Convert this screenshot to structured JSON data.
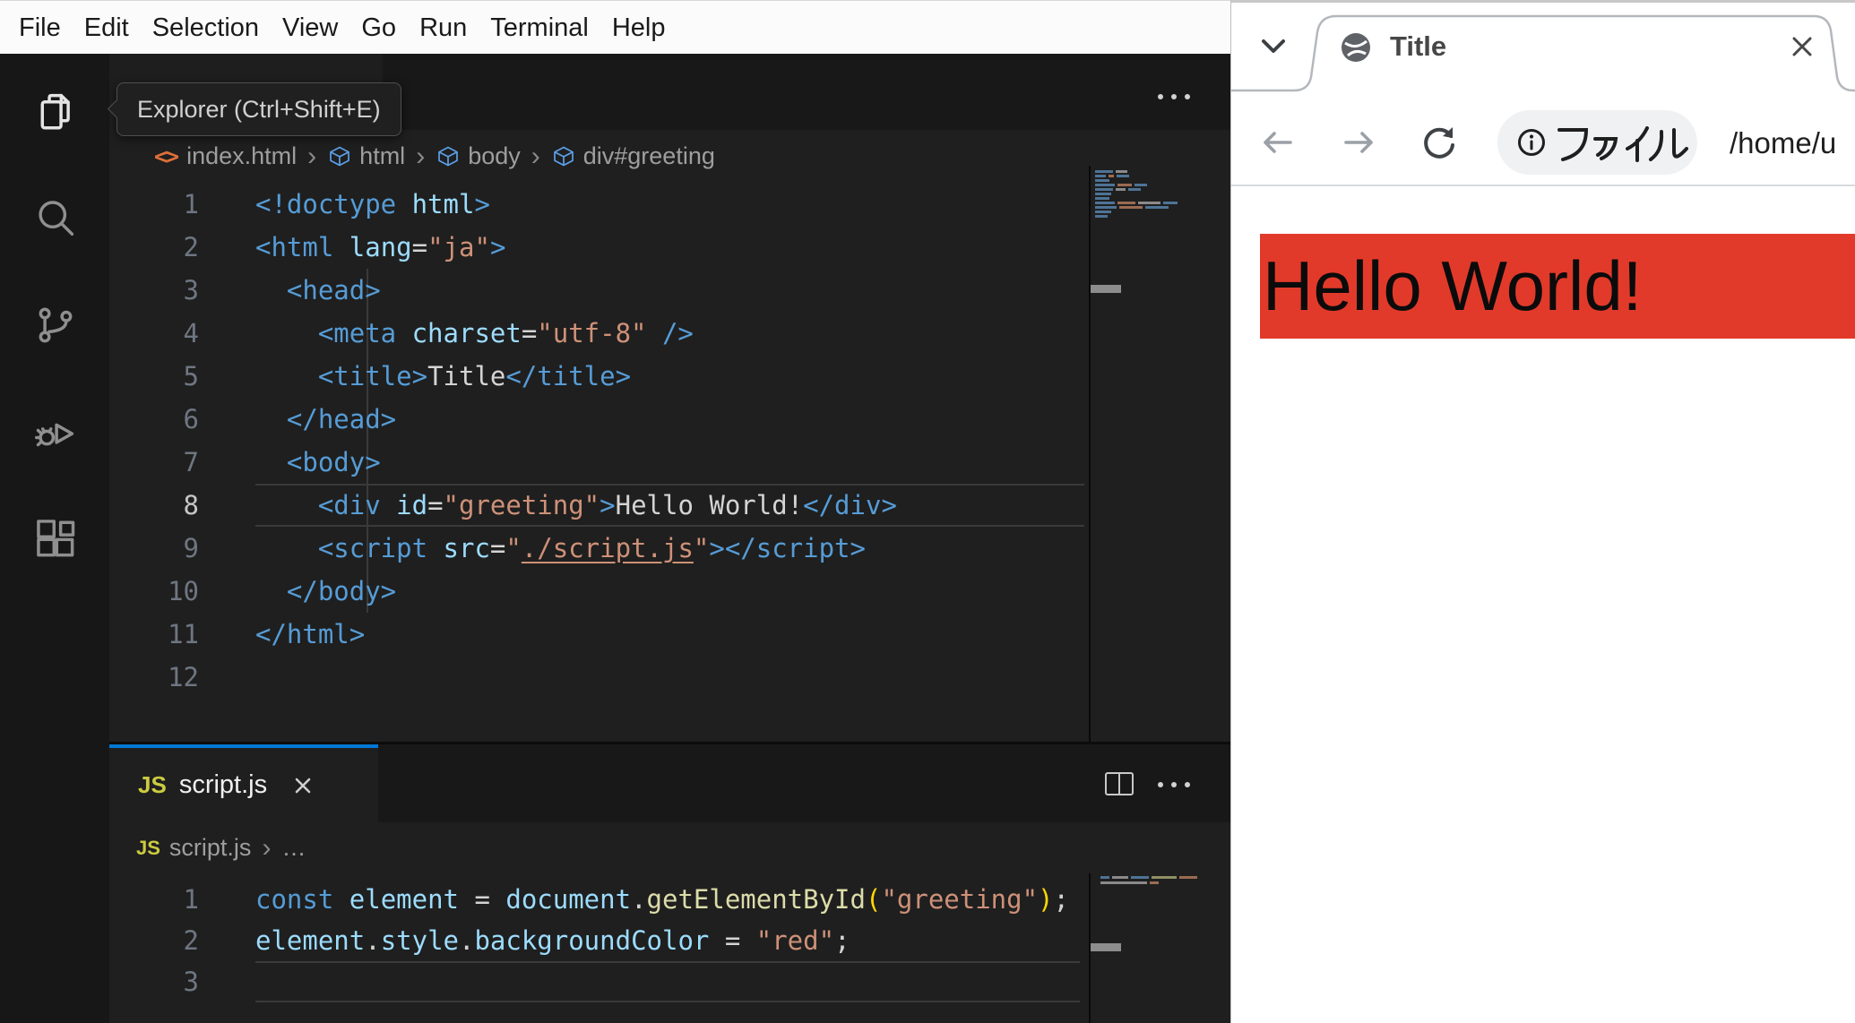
{
  "menu_bar": {
    "items": [
      "File",
      "Edit",
      "Selection",
      "View",
      "Go",
      "Run",
      "Terminal",
      "Help"
    ]
  },
  "activity_bar": {
    "tooltip": "Explorer (Ctrl+Shift+E)",
    "icons": [
      "explorer",
      "search",
      "source-control",
      "run-and-debug",
      "extensions"
    ]
  },
  "editor_top": {
    "breadcrumb": {
      "file_icon": "<>",
      "file": "index.html",
      "separator": "›",
      "symbols": [
        "html",
        "body",
        "div#greeting"
      ]
    },
    "active_line": 8,
    "lines": [
      [
        [
          "tag",
          "<!doctype"
        ],
        [
          "attr",
          " html"
        ],
        [
          "tag",
          ">"
        ]
      ],
      [
        [
          "tag",
          "<html"
        ],
        [
          "attr",
          " lang"
        ],
        [
          "pun",
          "="
        ],
        [
          "str",
          "\"ja\""
        ],
        [
          "tag",
          ">"
        ]
      ],
      [
        [
          "tag",
          "  <head>"
        ]
      ],
      [
        [
          "tag",
          "    <meta"
        ],
        [
          "attr",
          " charset"
        ],
        [
          "pun",
          "="
        ],
        [
          "str",
          "\"utf-8\""
        ],
        [
          "tag",
          " />"
        ]
      ],
      [
        [
          "tag",
          "    <title>"
        ],
        [
          "txt",
          "Title"
        ],
        [
          "tag",
          "</title>"
        ]
      ],
      [
        [
          "tag",
          "  </head>"
        ]
      ],
      [
        [
          "tag",
          "  <body>"
        ]
      ],
      [
        [
          "tag",
          "    <div"
        ],
        [
          "attr",
          " id"
        ],
        [
          "pun",
          "="
        ],
        [
          "str",
          "\"greeting\""
        ],
        [
          "tag",
          ">"
        ],
        [
          "txt",
          "Hello World!"
        ],
        [
          "tag",
          "</div>"
        ]
      ],
      [
        [
          "tag",
          "    <script"
        ],
        [
          "attr",
          " src"
        ],
        [
          "pun",
          "="
        ],
        [
          "str",
          "\""
        ],
        [
          "lnk",
          "./script.js"
        ],
        [
          "str",
          "\""
        ],
        [
          "tag",
          "></script>"
        ]
      ],
      [
        [
          "tag",
          "  </body>"
        ]
      ],
      [
        [
          "tag",
          "</html>"
        ]
      ],
      []
    ],
    "minimap": [
      [
        [
          "b",
          20
        ],
        [
          "w",
          13
        ]
      ],
      [
        [
          "b",
          12
        ],
        [
          "o",
          6
        ],
        [
          "b",
          14
        ]
      ],
      [
        [
          "b",
          16
        ]
      ],
      [
        [
          "b",
          22
        ],
        [
          "o",
          16
        ],
        [
          "b",
          14
        ]
      ],
      [
        [
          "b",
          20
        ],
        [
          "w",
          11
        ],
        [
          "b",
          14
        ]
      ],
      [
        [
          "b",
          18
        ]
      ],
      [
        [
          "b",
          16
        ]
      ],
      [
        [
          "b",
          22
        ],
        [
          "o",
          20
        ],
        [
          "w",
          25
        ],
        [
          "b",
          16
        ]
      ],
      [
        [
          "b",
          24
        ],
        [
          "o",
          26
        ],
        [
          "b",
          26
        ]
      ],
      [
        [
          "b",
          18
        ]
      ],
      [
        [
          "b",
          14
        ]
      ]
    ]
  },
  "editor_bottom": {
    "tab": {
      "icon": "JS",
      "label": "script.js"
    },
    "breadcrumb": {
      "icon": "JS",
      "file": "script.js",
      "separator": "›",
      "more": "…"
    },
    "active_line": 3,
    "lines": [
      [
        [
          "kw",
          "const"
        ],
        [
          "var",
          " element "
        ],
        [
          "pun",
          "= "
        ],
        [
          "var",
          "document"
        ],
        [
          "pun",
          "."
        ],
        [
          "fn",
          "getElementById"
        ],
        [
          "par",
          "("
        ],
        [
          "str",
          "\"greeting\""
        ],
        [
          "par",
          ")"
        ],
        [
          "pun",
          ";"
        ]
      ],
      [
        [
          "var",
          "element"
        ],
        [
          "pun",
          "."
        ],
        [
          "var",
          "style"
        ],
        [
          "pun",
          "."
        ],
        [
          "var",
          "backgroundColor"
        ],
        [
          "pun",
          " = "
        ],
        [
          "str",
          "\"red\""
        ],
        [
          "pun",
          ";"
        ]
      ],
      []
    ],
    "minimap": [
      [
        [
          "b",
          10
        ],
        [
          "w",
          18
        ],
        [
          "b",
          20
        ],
        [
          "y",
          28
        ],
        [
          "o",
          20
        ]
      ],
      [
        [
          "w",
          52
        ],
        [
          "o",
          10
        ]
      ]
    ]
  },
  "browser": {
    "tab": {
      "title": "Title"
    },
    "toolbar": {
      "file_chip": "ファイル",
      "url": "/home/u"
    },
    "content": {
      "text": "Hello World!"
    }
  },
  "colors": {
    "accent_tab_border": "#0078d4",
    "page_highlight_red": "#e23a2a",
    "editor_background": "#1f1f1f",
    "tab_strip_background": "#181818"
  }
}
